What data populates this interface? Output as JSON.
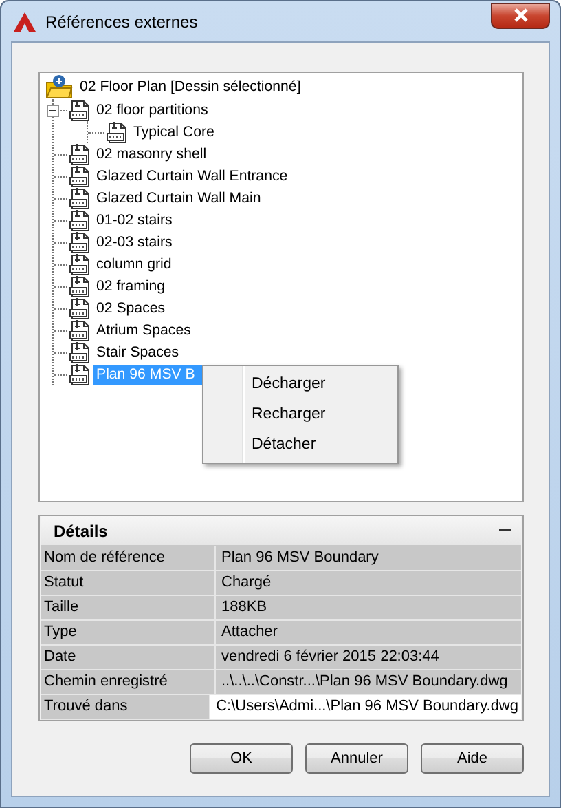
{
  "window": {
    "title": "Références externes"
  },
  "tree": {
    "label": "02 Floor Plan [Dessin sélectionné]",
    "kind": "root",
    "selected": false,
    "children": [
      {
        "label": "02 floor partitions",
        "kind": "file",
        "expanded": true,
        "selected": false,
        "children": [
          {
            "label": "Typical Core",
            "kind": "file",
            "selected": false
          }
        ]
      },
      {
        "label": "02 masonry shell",
        "kind": "file",
        "selected": false
      },
      {
        "label": "Glazed Curtain Wall Entrance",
        "kind": "file",
        "selected": false
      },
      {
        "label": "Glazed Curtain Wall Main",
        "kind": "file",
        "selected": false
      },
      {
        "label": "01-02 stairs",
        "kind": "file",
        "selected": false
      },
      {
        "label": "02-03 stairs",
        "kind": "file",
        "selected": false
      },
      {
        "label": "column grid",
        "kind": "file",
        "selected": false
      },
      {
        "label": "02 framing",
        "kind": "file",
        "selected": false
      },
      {
        "label": "02 Spaces",
        "kind": "file",
        "selected": false
      },
      {
        "label": "Atrium Spaces",
        "kind": "file",
        "selected": false
      },
      {
        "label": "Stair Spaces",
        "kind": "file",
        "selected": false
      },
      {
        "label": "Plan 96 MSV B",
        "kind": "file",
        "selected": true
      }
    ]
  },
  "context_menu": {
    "items": [
      "Décharger",
      "Recharger",
      "Détacher"
    ]
  },
  "details": {
    "title": "Détails",
    "expanded": true,
    "rows": [
      {
        "label": "Nom de référence",
        "value": "Plan 96 MSV Boundary",
        "editable": false
      },
      {
        "label": "Statut",
        "value": "Chargé",
        "editable": false
      },
      {
        "label": "Taille",
        "value": "188KB",
        "editable": false
      },
      {
        "label": "Type",
        "value": "Attacher",
        "editable": false
      },
      {
        "label": "Date",
        "value": "vendredi 6 février 2015  22:03:44",
        "editable": false
      },
      {
        "label": "Chemin enregistré",
        "value": "..\\..\\..\\Constr...\\Plan 96 MSV Boundary.dwg",
        "editable": false
      },
      {
        "label": "Trouvé dans",
        "value": "C:\\Users\\Admi...\\Plan 96 MSV Boundary.dwg",
        "editable": true
      }
    ]
  },
  "buttons": [
    "OK",
    "Annuler",
    "Aide"
  ]
}
